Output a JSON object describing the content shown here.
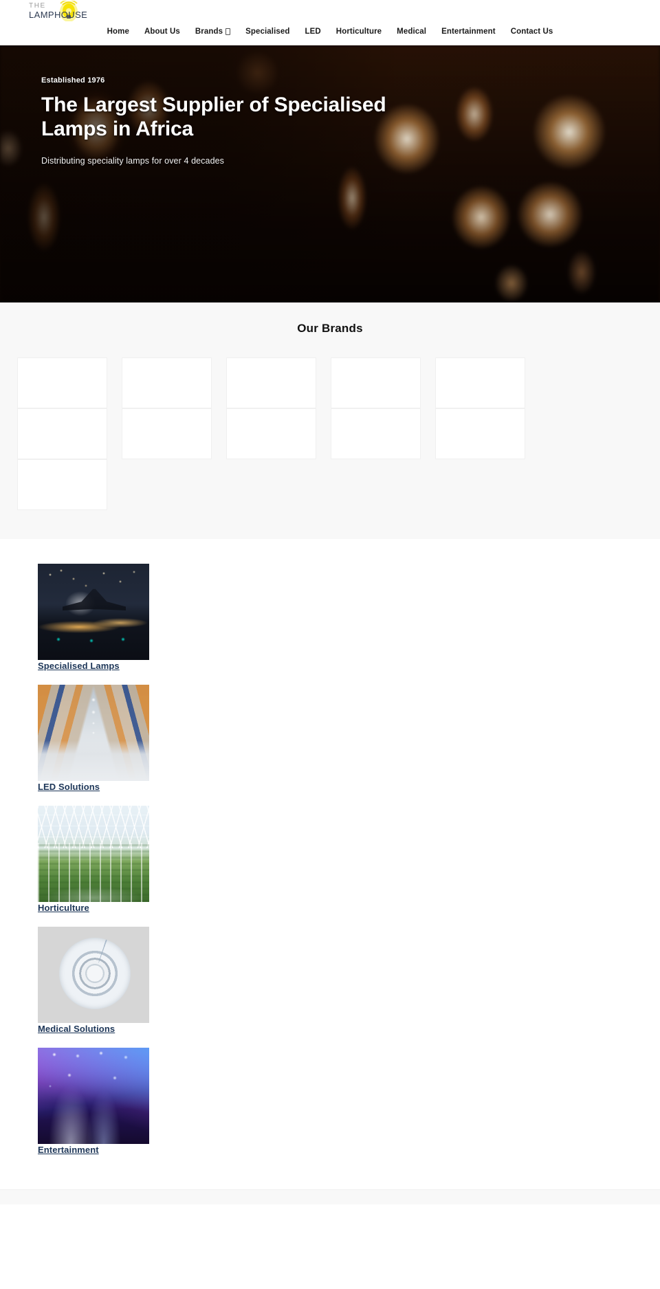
{
  "site": {
    "logo_line1": "THE",
    "logo_line2": "LAMPHOUSE",
    "logo_icon": "lightbulb-icon"
  },
  "nav": {
    "items": [
      {
        "label": "Home",
        "has_dropdown": false
      },
      {
        "label": "About Us",
        "has_dropdown": false
      },
      {
        "label": "Brands",
        "has_dropdown": true
      },
      {
        "label": "Specialised",
        "has_dropdown": false
      },
      {
        "label": "LED",
        "has_dropdown": false
      },
      {
        "label": "Horticulture",
        "has_dropdown": false
      },
      {
        "label": "Medical",
        "has_dropdown": false
      },
      {
        "label": "Entertainment",
        "has_dropdown": false
      },
      {
        "label": "Contact Us",
        "has_dropdown": false
      }
    ]
  },
  "hero": {
    "eyebrow": "Established 1976",
    "title": "The Largest Supplier of Specialised Lamps in Africa",
    "subtitle": "Distributing speciality lamps for over 4 decades"
  },
  "brands": {
    "title": "Our Brands",
    "tiles": [
      {
        "alt": ""
      },
      {
        "alt": ""
      },
      {
        "alt": ""
      },
      {
        "alt": ""
      },
      {
        "alt": ""
      },
      {
        "alt": ""
      },
      {
        "alt": ""
      },
      {
        "alt": ""
      },
      {
        "alt": ""
      },
      {
        "alt": ""
      },
      {
        "alt": ""
      }
    ]
  },
  "categories": [
    {
      "title": "Specialised Lamps",
      "image": "airplane-landing-at-night"
    },
    {
      "title": "LED Solutions",
      "image": "warehouse-aisle-interior"
    },
    {
      "title": "Horticulture",
      "image": "greenhouse-plant-rows"
    },
    {
      "title": "Medical Solutions",
      "image": "surgical-operating-light"
    },
    {
      "title": "Entertainment",
      "image": "stage-lighting-beams"
    }
  ],
  "colors": {
    "accent_navy": "#1c3557",
    "logo_yellow": "#f5e200",
    "section_bg": "#f8f8f8"
  }
}
